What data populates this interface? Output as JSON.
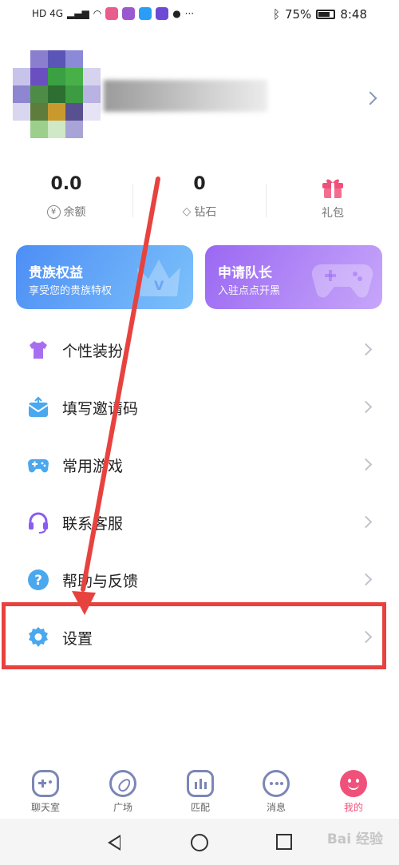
{
  "status_bar": {
    "network": "HD 4G",
    "battery": "75%",
    "time": "8:48"
  },
  "stats": [
    {
      "value": "0.0",
      "label": "余额",
      "icon": "yen-icon"
    },
    {
      "value": "0",
      "label": "钻石",
      "icon": "diamond-icon"
    },
    {
      "value": "",
      "label": "礼包",
      "icon": "gift-icon"
    }
  ],
  "cards": {
    "noble": {
      "title": "贵族权益",
      "subtitle": "享受您的贵族特权"
    },
    "captain": {
      "title": "申请队长",
      "subtitle": "入驻点点开黑"
    }
  },
  "menu": [
    {
      "label": "个性装扮",
      "icon": "tshirt-icon",
      "color": "#a76ff0"
    },
    {
      "label": "填写邀请码",
      "icon": "mail-icon",
      "color": "#4aa8ee"
    },
    {
      "label": "常用游戏",
      "icon": "gamepad-icon",
      "color": "#4aa8ee"
    },
    {
      "label": "联系客服",
      "icon": "headset-icon",
      "color": "#8a5cf0"
    },
    {
      "label": "帮助与反馈",
      "icon": "help-icon",
      "color": "#4aa8ee"
    },
    {
      "label": "设置",
      "icon": "gear-icon",
      "color": "#4aa8ee"
    }
  ],
  "tabs": [
    {
      "label": "聊天室",
      "icon": "gamepad-tab-icon"
    },
    {
      "label": "广场",
      "icon": "compass-icon"
    },
    {
      "label": "匹配",
      "icon": "match-icon"
    },
    {
      "label": "消息",
      "icon": "chat-bubble-icon"
    },
    {
      "label": "我的",
      "icon": "smiley-icon",
      "active": true
    }
  ],
  "colors": {
    "accent_pink": "#f0517a",
    "highlight_red": "#e8423f",
    "card_blue": "#4a95f5",
    "card_purple": "#a071f5"
  },
  "watermark": "Bai 经验"
}
